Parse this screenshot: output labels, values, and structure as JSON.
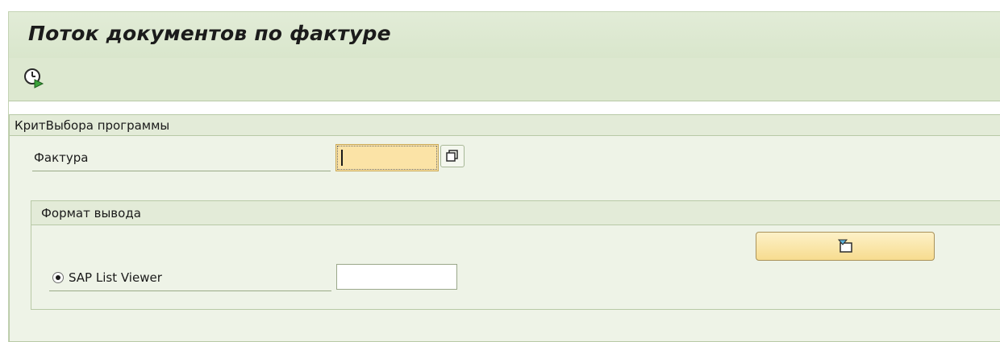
{
  "header": {
    "title": "Поток документов по фактуре"
  },
  "toolbar": {
    "execute_icon": "execute-clock-icon"
  },
  "selection": {
    "group_title": "КритВыбора программы",
    "billing_doc_label": "Фактура",
    "billing_doc_value": "",
    "multi_select_icon": "multiple-selection-icon"
  },
  "output_format": {
    "group_title": "Формат вывода",
    "alv_label": "SAP List Viewer",
    "alv_selected": true,
    "layout_value": "",
    "layout_button_icon": "layout-select-icon"
  },
  "colors": {
    "title_bg": "#dde8d0",
    "group_bg": "#eef3e7",
    "required_input_bg": "#fbe3a6",
    "button_bg": "#f7dc8f"
  }
}
